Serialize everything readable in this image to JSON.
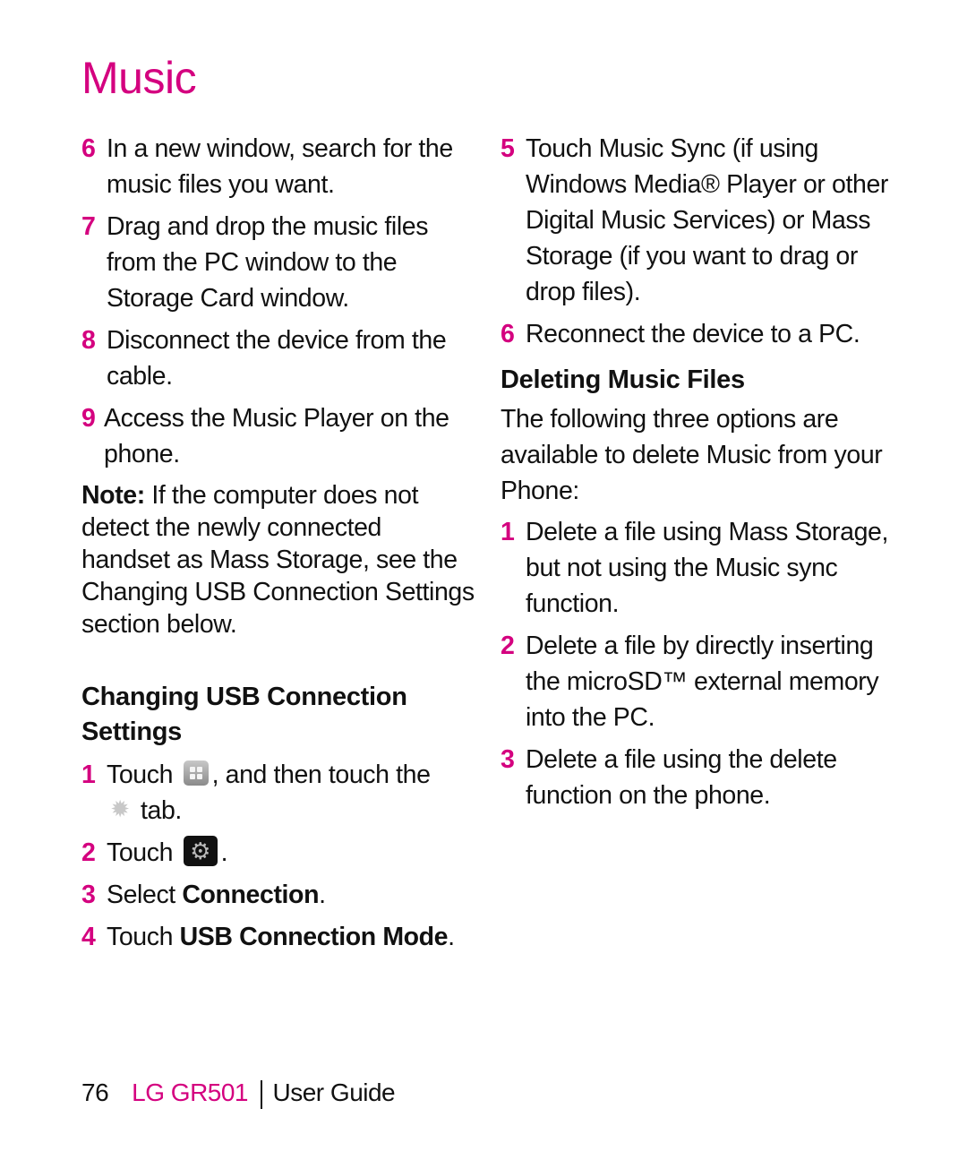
{
  "page_title": "Music",
  "left": {
    "steps_top": [
      {
        "num": "6",
        "text": "In a new window, search for the music files you want."
      },
      {
        "num": "7",
        "text": "Drag and drop the music files from the PC window to the Storage Card window."
      },
      {
        "num": "8",
        "text": "Disconnect the device from the cable."
      },
      {
        "num": "9",
        "text": "Access the Music Player on the phone."
      }
    ],
    "note": {
      "label": "Note:",
      "text": " If the computer does not detect the newly connected handset as Mass Storage, see the Changing USB Connection Settings section below."
    },
    "usb_heading": "Changing USB Connection Settings",
    "usb_steps": {
      "s1": {
        "num": "1",
        "pre": "Touch",
        "mid": ", and then touch the",
        "post": "tab.",
        "icon1": "apps-grid-icon",
        "icon2": "settings-gear-icon"
      },
      "s2": {
        "num": "2",
        "pre": "Touch",
        "post": ".",
        "icon": "settings-gear-dark-icon"
      },
      "s3": {
        "num": "3",
        "pre": "Select ",
        "bold": "Connection",
        "post": "."
      },
      "s4": {
        "num": "4",
        "pre": "Touch ",
        "bold": "USB Connection Mode",
        "post": "."
      }
    }
  },
  "right": {
    "steps_top": [
      {
        "num": "5",
        "text": "Touch Music Sync (if using Windows Media® Player or other Digital Music Services) or Mass Storage (if you want to drag or drop files)."
      },
      {
        "num": "6",
        "text": "Reconnect the device to a PC."
      }
    ],
    "delete_heading": "Deleting Music Files",
    "delete_intro": "The following three options are available to delete Music from your Phone:",
    "delete_steps": [
      {
        "num": "1",
        "text": "Delete a file using Mass Storage, but not using the Music sync function."
      },
      {
        "num": "2",
        "text": "Delete a file by directly inserting the microSD™ external memory into the PC."
      },
      {
        "num": "3",
        "text": "Delete a file using the delete function on the phone."
      }
    ]
  },
  "footer": {
    "page_number": "76",
    "brand": "LG GR501",
    "guide": "User Guide"
  },
  "colors": {
    "accent": "#d4007f",
    "text": "#111111"
  }
}
